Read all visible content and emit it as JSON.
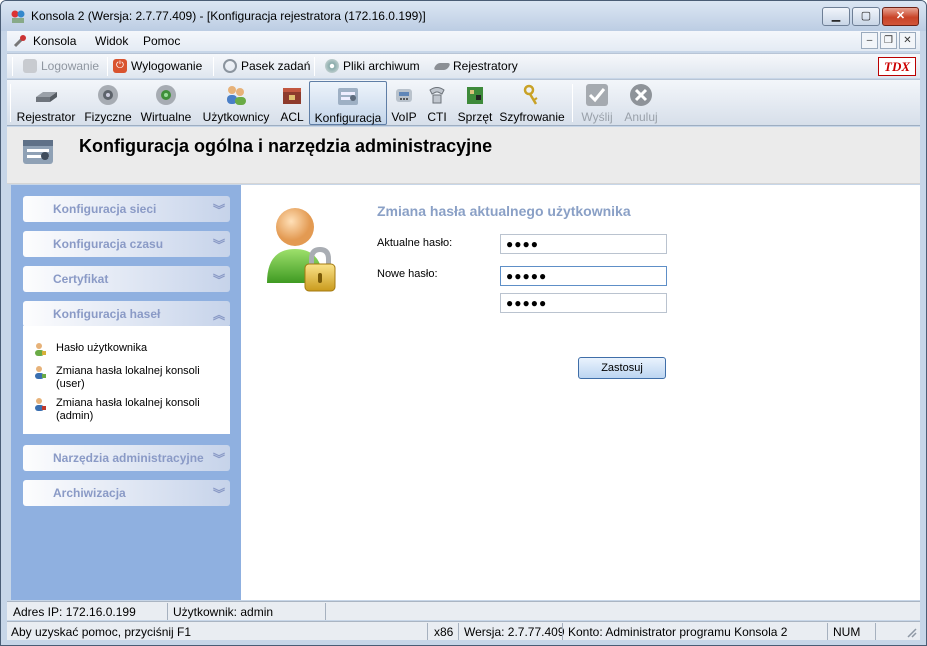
{
  "window": {
    "title": "Konsola 2 (Wersja:  2.7.77.409) - [Konfiguracja rejestratora (172.16.0.199)]"
  },
  "menu": {
    "items": [
      "Konsola",
      "Widok",
      "Pomoc"
    ]
  },
  "quickbar": {
    "items": [
      {
        "label": "Logowanie",
        "icon": "key-icon",
        "disabled": true
      },
      {
        "label": "Wylogowanie",
        "icon": "power-icon",
        "disabled": false
      },
      {
        "label": "Pasek zadań",
        "icon": "clip-icon",
        "disabled": false
      },
      {
        "label": "Pliki archiwum",
        "icon": "disc-icon",
        "disabled": false
      },
      {
        "label": "Rejestratory",
        "icon": "recorder-icon",
        "disabled": false
      }
    ],
    "logo": "TDX"
  },
  "toolbar": {
    "buttons": [
      {
        "label": "Rejestrator",
        "icon": "recorder-icon"
      },
      {
        "label": "Fizyczne",
        "icon": "speaker-icon"
      },
      {
        "label": "Wirtualne",
        "icon": "speaker-green-icon"
      },
      {
        "label": "Użytkownicy",
        "icon": "users-icon"
      },
      {
        "label": "ACL",
        "icon": "acl-icon"
      },
      {
        "label": "Konfiguracja",
        "icon": "config-icon"
      },
      {
        "label": "VoIP",
        "icon": "voip-icon"
      },
      {
        "label": "CTI",
        "icon": "cti-icon"
      },
      {
        "label": "Sprzęt",
        "icon": "hardware-icon"
      },
      {
        "label": "Szyfrowanie",
        "icon": "keys-icon"
      },
      {
        "label": "Wyślij",
        "icon": "check-icon"
      },
      {
        "label": "Anuluj",
        "icon": "cancel-icon"
      }
    ]
  },
  "header": {
    "title": "Konfiguracja ogólna i narzędzia administracyjne"
  },
  "sidebar": {
    "sections": [
      {
        "label": "Konfiguracja sieci"
      },
      {
        "label": "Konfiguracja czasu"
      },
      {
        "label": "Certyfikat"
      },
      {
        "label": "Konfiguracja haseł"
      },
      {
        "label": "Narzędzia administracyjne"
      },
      {
        "label": "Archiwizacja"
      }
    ],
    "links": [
      {
        "label": "Hasło użytkownika"
      },
      {
        "label": "Zmiana hasła lokalnej konsoli (user)"
      },
      {
        "label": "Zmiana hasła lokalnej konsoli (admin)"
      }
    ]
  },
  "form": {
    "title": "Zmiana hasła aktualnego użytkownika",
    "current_label": "Aktualne hasło:",
    "current_value": "●●●●",
    "new_label": "Nowe hasło:",
    "new_value": "●●●●●",
    "confirm_value": "●●●●●",
    "apply": "Zastosuj"
  },
  "status": {
    "ip": "Adres IP: 172.16.0.199",
    "user": "Użytkownik: admin",
    "help": "Aby uzyskać pomoc, przyciśnij F1",
    "arch": "x86",
    "version": "Wersja: 2.7.77.409",
    "account": "Konto: Administrator programu Konsola 2",
    "num": "NUM"
  }
}
